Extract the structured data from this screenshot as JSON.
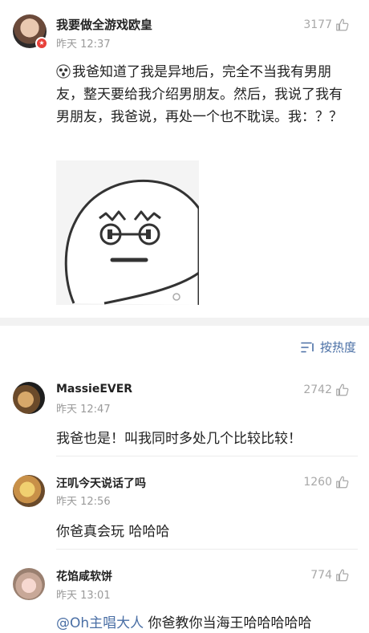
{
  "post": {
    "username": "我要做全游戏欧皇",
    "time": "昨天 12:37",
    "likes": "3177",
    "text": "我爸知道了我是异地后，完全不当我有男朋友，整天要给我介绍男朋友。然后，我说了我有男朋友，我爸说，再处一个也不耽误。我：？？"
  },
  "sort_label": "按热度",
  "comments": [
    {
      "username": "MassieEVER",
      "time": "昨天 12:47",
      "likes": "2742",
      "text": "我爸也是！叫我同时多处几个比较比较！"
    },
    {
      "username": "汪叽今天说话了吗",
      "time": "昨天 12:56",
      "likes": "1260",
      "text": "你爸真会玩 哈哈哈"
    },
    {
      "username": "花馅咸软饼",
      "time": "昨天 13:01",
      "likes": "774",
      "mention": "@Oh主唱大人",
      "text": " 你爸教你当海王哈哈哈哈哈"
    }
  ],
  "colors": {
    "link": "#4a6fa5",
    "muted": "#9a9a9a",
    "badge": "#e8403a"
  }
}
